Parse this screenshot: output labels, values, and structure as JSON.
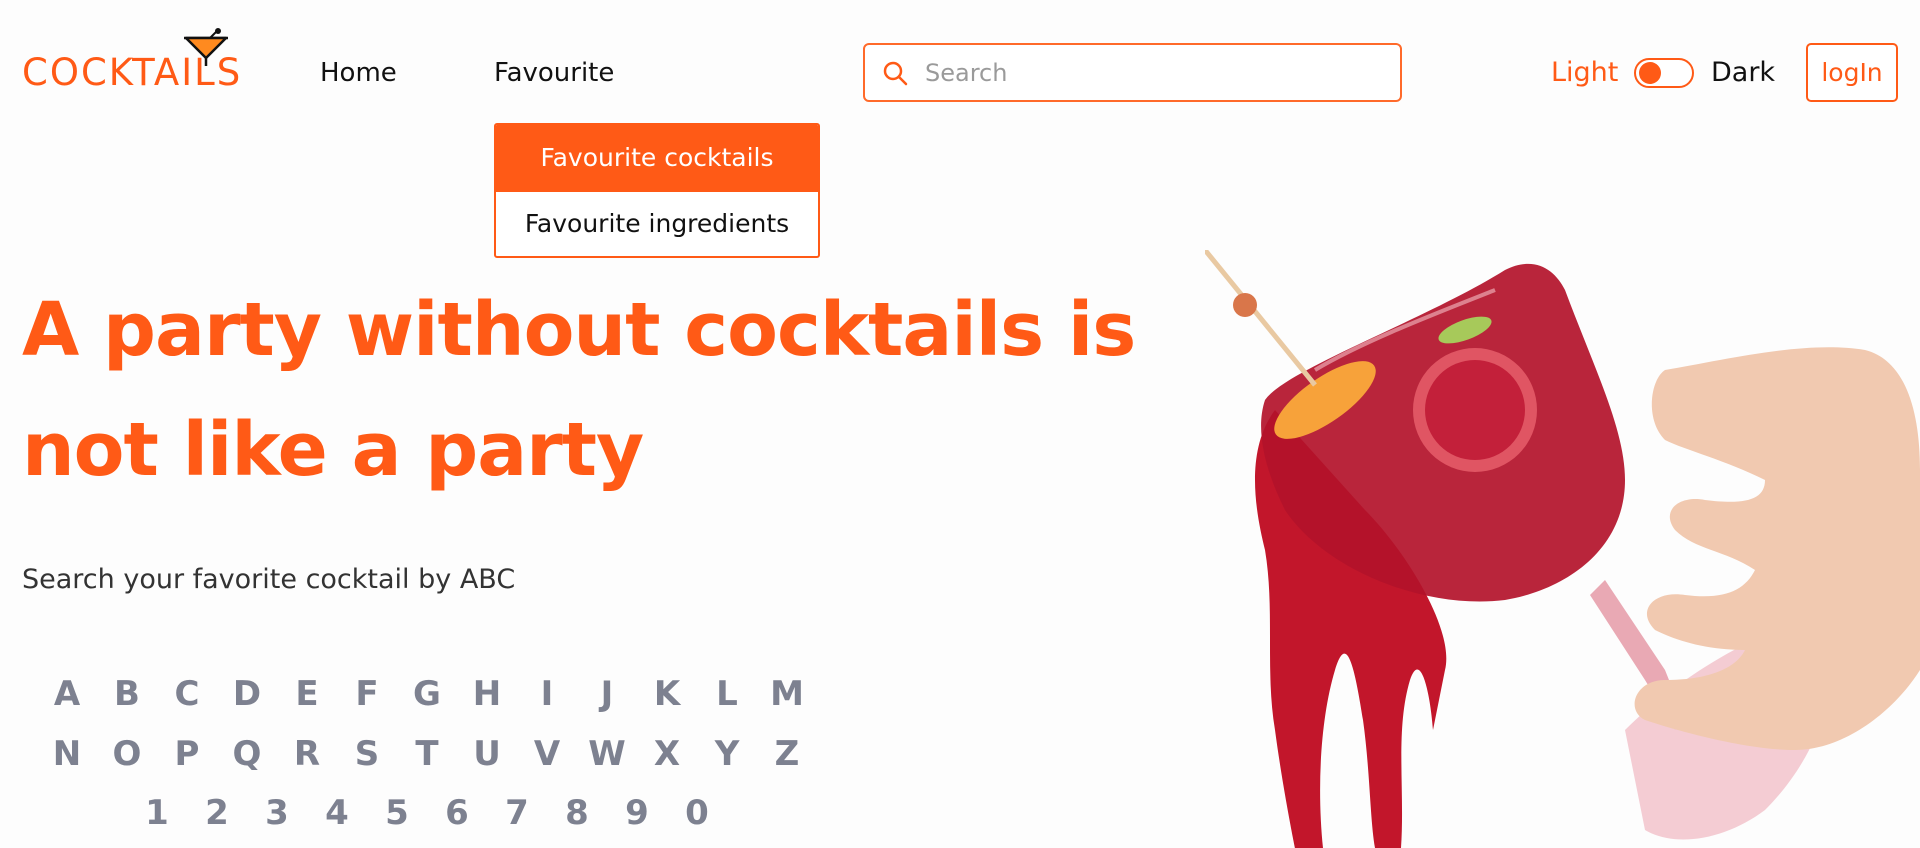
{
  "header": {
    "logo_text": "COCKTAILS",
    "nav": {
      "home": "Home",
      "favourite": "Favourite"
    },
    "dropdown": {
      "items": [
        {
          "label": "Favourite cocktails",
          "active": true
        },
        {
          "label": "Favourite ingredients",
          "active": false
        }
      ]
    },
    "search": {
      "placeholder": "Search",
      "value": "",
      "icon": "search-icon"
    },
    "theme": {
      "light_label": "Light",
      "dark_label": "Dark",
      "mode": "light"
    },
    "login_label": "logIn"
  },
  "hero": {
    "headline_line1": "A party without cocktails is",
    "headline_line2": "not like a party",
    "subtitle": "Search your favorite cocktail by ABC",
    "image": "cocktail-glass-hand-splash"
  },
  "alphabet": {
    "row1": [
      "A",
      "B",
      "C",
      "D",
      "E",
      "F",
      "G",
      "H",
      "I",
      "J",
      "K",
      "L",
      "M"
    ],
    "row2": [
      "N",
      "O",
      "P",
      "Q",
      "R",
      "S",
      "T",
      "U",
      "V",
      "W",
      "X",
      "Y",
      "Z"
    ],
    "row3": [
      "1",
      "2",
      "3",
      "4",
      "5",
      "6",
      "7",
      "8",
      "9",
      "0"
    ]
  },
  "colors": {
    "accent": "#ff5a16",
    "letters": "#7d8190",
    "text": "#111111"
  }
}
